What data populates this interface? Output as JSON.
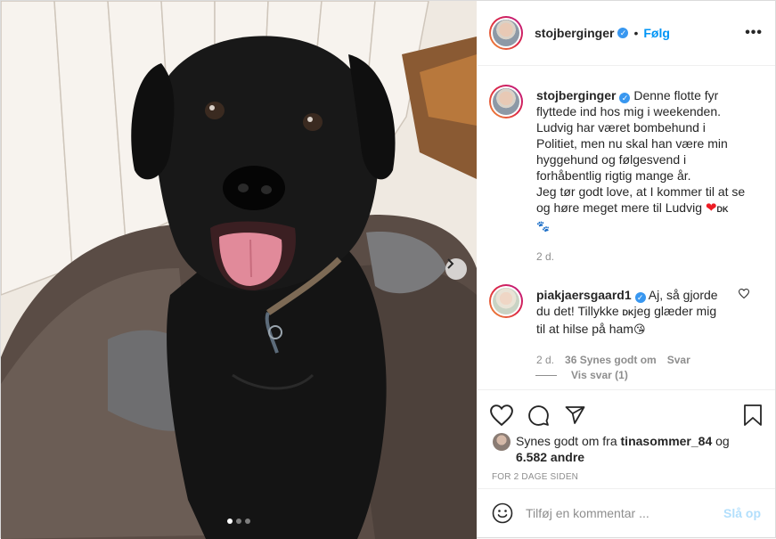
{
  "post": {
    "author": "stojberginger",
    "follow_label": "Følg",
    "more_icon": "more-options-icon",
    "caption": {
      "username": "stojberginger",
      "lines": [
        "Denne flotte fyr",
        "flyttede ind hos mig i weekenden.",
        "Ludvig har været bombehund i",
        "Politiet, men nu skal han være min",
        "hyggehund og følgesvend i",
        "forhåbentlig rigtig mange år.",
        "Jeg tør godt love, at I kommer til at se",
        "og høre meget mere til Ludvig"
      ],
      "flag": "DK",
      "time": "2 d."
    },
    "comment": {
      "username": "piakjaersgaard1",
      "text_a": "Aj, så gjorde",
      "text_b": "du det! Tillykke",
      "flag": "DK",
      "text_c": "jeg glæder mig",
      "text_d": "til at hilse på ham",
      "time": "2 d.",
      "likes": "36 Synes godt om",
      "reply_label": "Svar",
      "view_replies": "Vis svar (1)"
    },
    "likes": {
      "prefix": "Synes godt om fra",
      "user": "tinasommer_84",
      "and": "og",
      "others": "6.582 andre"
    },
    "timestamp": "FOR 2 DAGE SIDEN",
    "comment_input": {
      "placeholder": "Tilføj en kommentar ..."
    },
    "post_button": "Slå op",
    "carousel": {
      "slides": 3,
      "current": 1
    },
    "colors": {
      "link": "#0095f6",
      "muted": "#8e8e8e",
      "verified": "#3897f0",
      "post_disabled": "#b2dffc"
    }
  }
}
